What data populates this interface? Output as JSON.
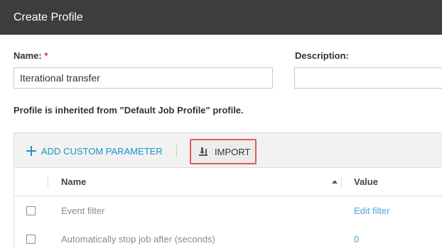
{
  "header": {
    "title": "Create Profile"
  },
  "form": {
    "name_label": "Name:",
    "name_required_mark": "*",
    "name_value": "Iterational transfer",
    "description_label": "Description:",
    "description_value": ""
  },
  "inherit_note": "Profile is inherited from \"Default Job Profile\" profile.",
  "toolbar": {
    "add_param_label": "ADD CUSTOM PARAMETER",
    "add_param_icon": "plus-icon",
    "import_label": "IMPORT",
    "import_icon": "import-icon",
    "accent_color": "#1a93c9",
    "highlight_color": "#e25c57"
  },
  "table": {
    "columns": [
      "Name",
      "Value"
    ],
    "sort": {
      "column": "Name",
      "direction": "ascending"
    },
    "rows": [
      {
        "name": "Event filter",
        "value": "Edit filter"
      },
      {
        "name": "Automatically stop job after (seconds)",
        "value": "0"
      }
    ]
  }
}
